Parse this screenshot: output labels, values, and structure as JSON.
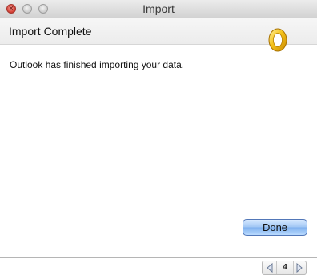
{
  "window": {
    "title": "Import"
  },
  "header": {
    "title": "Import Complete",
    "logo_icon": "outlook-logo-icon",
    "accent_color": "#f2b600"
  },
  "main": {
    "message": "Outlook has finished importing your data."
  },
  "buttons": {
    "done_label": "Done"
  },
  "pager": {
    "page_number": "4",
    "prev_icon": "left-arrow-icon",
    "next_icon": "right-arrow-icon"
  }
}
